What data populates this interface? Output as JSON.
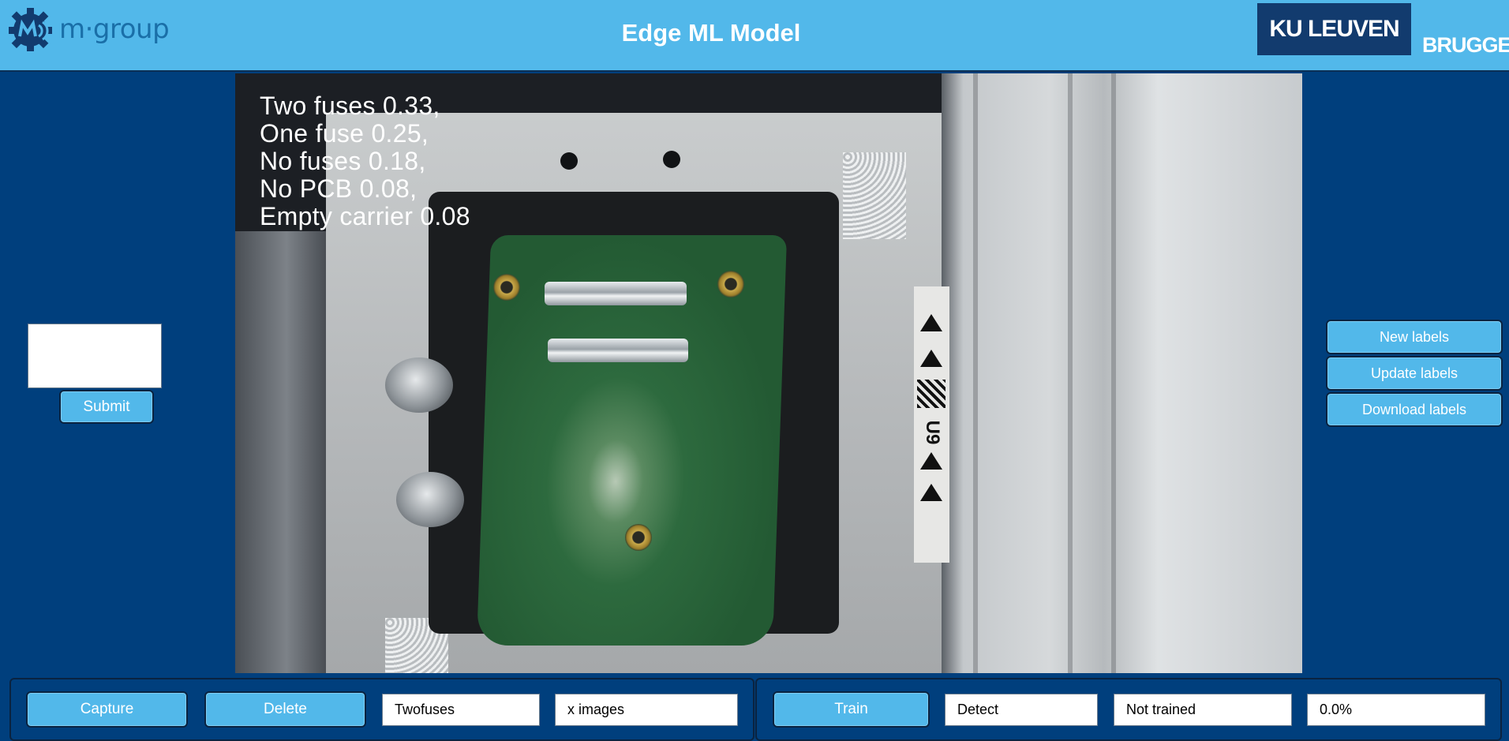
{
  "header": {
    "logo_text": "m·group",
    "title": "Edge ML Model",
    "university": "KU LEUVEN",
    "campus": "BRUGGE"
  },
  "left_panel": {
    "textarea_value": "",
    "submit_label": "Submit"
  },
  "predictions": [
    "Two fuses 0.33,",
    "One fuse 0.25,",
    "No fuses 0.18,",
    "No PCB 0.08,",
    "Empty carrier 0.08"
  ],
  "right_panel": {
    "new_labels": "New labels",
    "update_labels": "Update labels",
    "download_labels": "Download labels"
  },
  "bottom_bar": {
    "capture_label": "Capture",
    "delete_label": "Delete",
    "class_value": "Twofuses",
    "images_value": "x images",
    "train_label": "Train",
    "detect_value": "Detect",
    "status_value": "Not trained",
    "progress_value": "0.0%"
  },
  "camera_text": {
    "strip_code": "U9"
  },
  "colors": {
    "header_bg": "#52b8ea",
    "page_bg": "#003f7d",
    "button_bg": "#52b8ea",
    "ku_box": "#123b6e"
  }
}
